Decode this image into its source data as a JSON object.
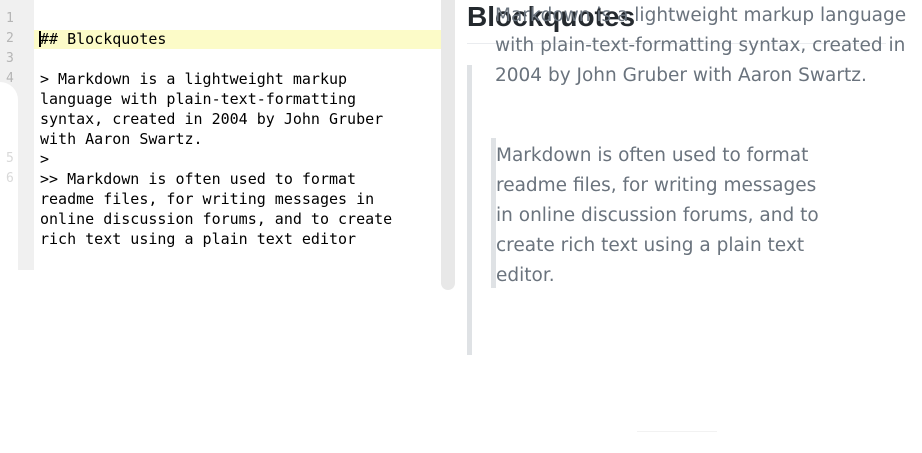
{
  "editor": {
    "line_numbers": [
      "1",
      "2",
      "3",
      "4",
      "5",
      "6"
    ],
    "lines": [
      "## Blockquotes",
      "> Markdown is a lightweight markup",
      "language with plain-text-formatting",
      "syntax, created in 2004 by John Gruber",
      "with Aaron Swartz.",
      ">",
      ">> Markdown is often used to format",
      "readme files, for writing messages in",
      "online discussion forums, and to create",
      "rich text using a plain text editor"
    ]
  },
  "preview": {
    "heading": "Blockquotes",
    "quote1": "Markdown is a lightweight markup language with plain-text-formatting syntax, created in 2004 by John Gruber with Aaron Swartz.",
    "quote2": "Markdown is often used to format readme files, for writing messages in online discussion forums, and to create rich text using a plain text editor."
  },
  "colors": {
    "active_line": "#fcfbc8",
    "quote_text": "#6a737d",
    "quote_border": "#dfe2e5",
    "heading": "#24292e"
  }
}
